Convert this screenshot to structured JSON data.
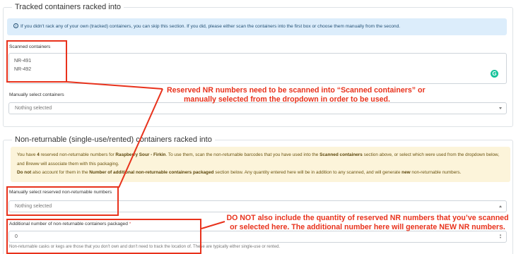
{
  "tracked": {
    "legend": "Tracked containers racked into",
    "info_icon": "info-circle-icon",
    "info_text": "If you didn't rack any of your own (tracked) containers, you can skip this section. If you did, please either scan the containers into the first box or choose them manually from the second.",
    "scanned_label": "Scanned containers",
    "scanned_items": [
      "NR-491",
      "NR-492"
    ],
    "grammarly_letter": "G",
    "manual_label": "Manually select containers",
    "manual_value": "Nothing selected"
  },
  "nonreturnable": {
    "legend": "Non-returnable (single-use/rented) containers racked into",
    "warn_1": "You have ",
    "warn_count": "4",
    "warn_2": " reserved non-returnable numbers for ",
    "warn_product": "Raspberry Sour - Firkin",
    "warn_3": ". To use them, scan the non-returnable barcodes that you have used into the ",
    "warn_scanned": "Scanned containers",
    "warn_4": " section above, or select which were used from the dropdown below, and Breww will associate them with this packaging.",
    "warn_do_not": "Do not",
    "warn_5": " also account for them in the ",
    "warn_number_field": "Number of additional non-returnable containers packaged",
    "warn_6": " section below. Any quantity entered here will be in addition to any scanned, and will generate ",
    "warn_new": "new",
    "warn_7": " non-returnable numbers.",
    "reserved_label": "Manually select reserved non-returnable numbers",
    "reserved_value": "Nothing selected",
    "additional_label": "Additional number of non-returnable containers packaged",
    "required_mark": "*",
    "additional_value": "0",
    "help_text": "Non-returnable casks or kegs are those that you don't own and don't need to track the location of. These are typically either single-use or rented."
  },
  "annotations": {
    "top_1": "Reserved NR numbers need to be scanned into “Scanned containers” or",
    "top_2": "manually selected from the dropdown in order to be used.",
    "bottom_1": "DO NOT also include the quantity of reserved NR numbers that you’ve scanned",
    "bottom_2": "or selected here. The additional number here will generate NEW NR numbers.",
    "color": "#e8321c"
  }
}
